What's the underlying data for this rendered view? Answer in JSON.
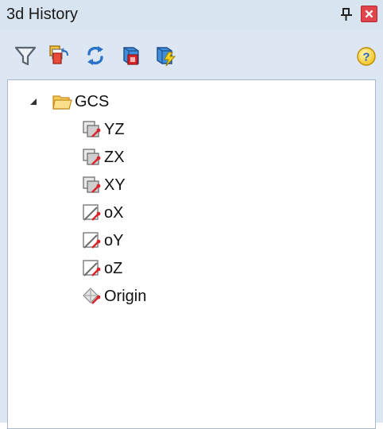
{
  "panel": {
    "title": "3d History"
  },
  "toolbar": {
    "buttons": [
      {
        "icon": "filter-icon"
      },
      {
        "icon": "history-edit-icon"
      },
      {
        "icon": "refresh-icon"
      },
      {
        "icon": "rebuild-icon"
      },
      {
        "icon": "rebuild-all-icon"
      }
    ],
    "help_icon": "help-icon"
  },
  "tree": {
    "root": {
      "label": "GCS",
      "icon": "folder-icon",
      "expanded": true
    },
    "children": [
      {
        "label": "YZ",
        "icon": "plane-icon"
      },
      {
        "label": "ZX",
        "icon": "plane-icon"
      },
      {
        "label": "XY",
        "icon": "plane-icon"
      },
      {
        "label": "oX",
        "icon": "axis-icon"
      },
      {
        "label": "oY",
        "icon": "axis-icon"
      },
      {
        "label": "oZ",
        "icon": "axis-icon"
      },
      {
        "label": "Origin",
        "icon": "point-icon"
      }
    ]
  },
  "colors": {
    "accent_red": "#d8262c",
    "panel_bg": "#dde7f3",
    "close_red": "#e0454b"
  }
}
